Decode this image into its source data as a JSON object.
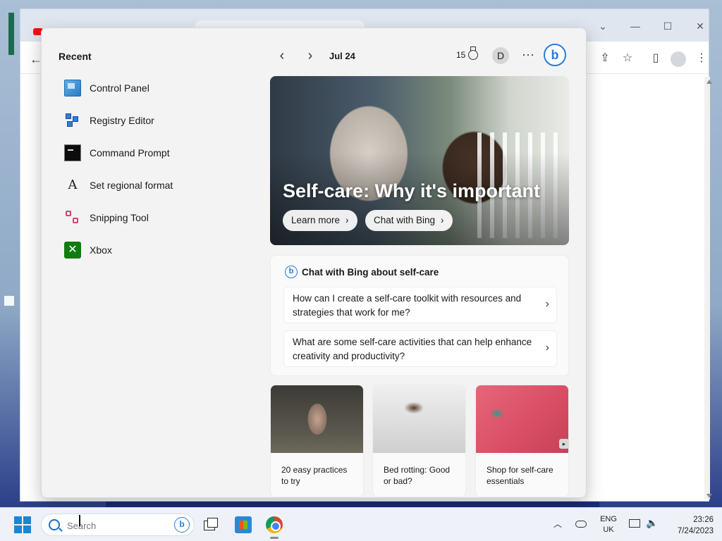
{
  "panel": {
    "recent_title": "Recent",
    "recent_items": [
      {
        "label": "Control Panel",
        "icon": "control-panel-icon"
      },
      {
        "label": "Registry Editor",
        "icon": "registry-editor-icon"
      },
      {
        "label": "Command Prompt",
        "icon": "command-prompt-icon"
      },
      {
        "label": "Set regional format",
        "icon": "regional-format-icon"
      },
      {
        "label": "Snipping Tool",
        "icon": "snipping-tool-icon"
      },
      {
        "label": "Xbox",
        "icon": "xbox-icon"
      }
    ],
    "header": {
      "prev_icon": "chevron-left-icon",
      "next_icon": "chevron-right-icon",
      "date": "Jul 24",
      "streak_count": "15",
      "user_initial": "D",
      "more_icon": "more-dots-icon",
      "bing_letter": "b"
    },
    "hero": {
      "title": "Self-care: Why it's important",
      "learn_more": "Learn more",
      "chat_with_bing": "Chat with Bing"
    },
    "chat_card": {
      "title": "Chat with Bing about self-care",
      "suggestions": [
        "How can I create a self-care toolkit with resources and strategies that work for me?",
        "What are some self-care activities that can help enhance creativity and productivity?"
      ]
    },
    "cards": [
      {
        "text": "20 easy practices to try"
      },
      {
        "text": "Bed rotting: Good or bad?"
      },
      {
        "text": "Shop for self-care essentials"
      }
    ]
  },
  "taskbar": {
    "search_placeholder": "Search",
    "lang_line1": "ENG",
    "lang_line2": "UK",
    "time": "23:26",
    "date": "7/24/2023"
  },
  "colors": {
    "accent": "#2b7bd6",
    "panel_bg": "#f3f3f3",
    "taskbar_bg": "#eef2f8",
    "start_blue": "#1a86d8",
    "xbox_green": "#107c10"
  }
}
